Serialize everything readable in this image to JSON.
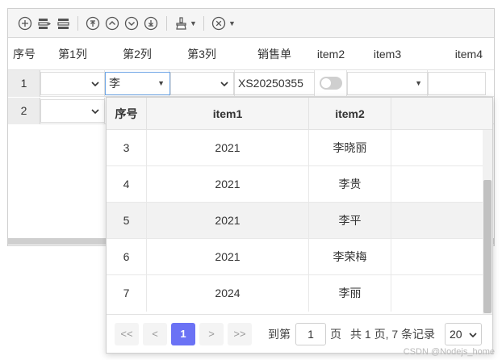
{
  "header": {
    "columns": [
      "序号",
      "第1列",
      "第2列",
      "第3列",
      "销售单",
      "item2",
      "item3",
      "item4"
    ]
  },
  "rows": [
    {
      "index": "1",
      "col2_value": "李",
      "sales_order": "XS20250355",
      "item2_toggle": "off"
    },
    {
      "index": "2"
    }
  ],
  "popup": {
    "headers": [
      "序号",
      "item1",
      "item2"
    ],
    "rows": [
      {
        "seq": "3",
        "item1": "2021",
        "item2": "李晓丽"
      },
      {
        "seq": "4",
        "item1": "2021",
        "item2": "李贵"
      },
      {
        "seq": "5",
        "item1": "2021",
        "item2": "李平"
      },
      {
        "seq": "6",
        "item1": "2021",
        "item2": "李荣梅"
      },
      {
        "seq": "7",
        "item1": "2024",
        "item2": "李丽"
      }
    ],
    "highlighted_row_seq": "5",
    "pager": {
      "first": "<<",
      "prev": "<",
      "current_page": "1",
      "next": ">",
      "last": ">>",
      "goto_prefix": "到第",
      "goto_value": "1",
      "goto_suffix": "页",
      "summary": "共 1 页, 7 条记录",
      "page_size": "20"
    }
  },
  "colors": {
    "accent": "#6b72f5",
    "focus_border": "#6fa6e6"
  },
  "icons": {
    "toolbar": [
      "add-circle-icon",
      "insert-row-before-icon",
      "insert-row-after-icon",
      "move-top-icon",
      "move-up-icon",
      "move-down-icon",
      "move-bottom-icon",
      "clear-brush-icon",
      "delete-circle-icon"
    ]
  },
  "watermark": "CSDN @Nodejs_home"
}
